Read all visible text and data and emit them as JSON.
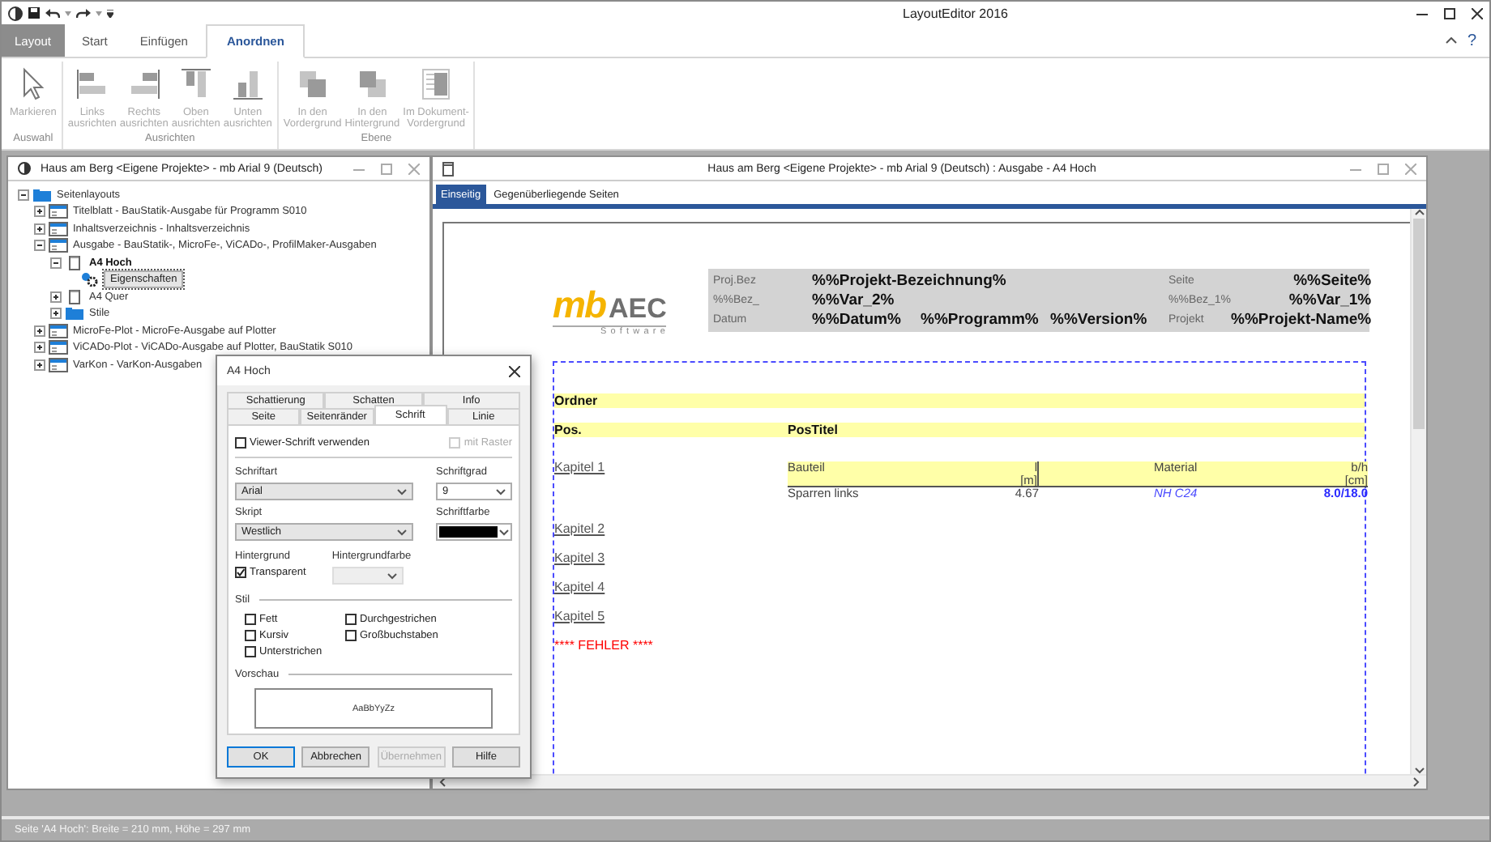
{
  "app": {
    "title": "LayoutEditor 2016"
  },
  "ribbon": {
    "tabs": [
      {
        "label": "Layout",
        "kind": "file",
        "selected": false
      },
      {
        "label": "Start",
        "kind": "tab",
        "selected": false
      },
      {
        "label": "Einfügen",
        "kind": "tab",
        "selected": false
      },
      {
        "label": "Anordnen",
        "kind": "tab",
        "selected": true
      }
    ],
    "help": "?",
    "groups": [
      {
        "label": "Auswahl",
        "buttons": [
          {
            "label": "Markieren",
            "disabled": true
          }
        ]
      },
      {
        "label": "Ausrichten",
        "buttons": [
          {
            "label": "Links\nausrichten",
            "disabled": true
          },
          {
            "label": "Rechts\nausrichten",
            "disabled": true
          },
          {
            "label": "Oben\nausrichten",
            "disabled": true
          },
          {
            "label": "Unten\nausrichten",
            "disabled": true
          }
        ]
      },
      {
        "label": "Ebene",
        "buttons": [
          {
            "label": "In den\nVordergrund",
            "disabled": true
          },
          {
            "label": "In den\nHintergrund",
            "disabled": true
          },
          {
            "label": "Im Dokument-\nVordergrund",
            "disabled": true
          }
        ]
      }
    ]
  },
  "tree_window": {
    "title": "Haus am Berg <Eigene Projekte> - mb Arial 9 (Deutsch)",
    "tree": [
      {
        "label": "Seitenlayouts",
        "kind": "folder",
        "expanded": true,
        "selected": false,
        "current": false,
        "children": [
          {
            "label": "Titelblatt - BauStatik-Ausgabe für Programm S010",
            "kind": "layout",
            "expanded": false,
            "selected": false,
            "current": false
          },
          {
            "label": "Inhaltsverzeichnis - Inhaltsverzeichnis",
            "kind": "layout",
            "expanded": false,
            "selected": false,
            "current": false
          },
          {
            "label": "Ausgabe - BauStatik-, MicroFe-, ViCADo-, ProfilMaker-Ausgaben",
            "kind": "layout",
            "expanded": true,
            "selected": false,
            "current": false,
            "children": [
              {
                "label": "A4 Hoch",
                "kind": "page",
                "expanded": true,
                "selected": false,
                "current": true,
                "children": [
                  {
                    "label": "Eigenschaften",
                    "kind": "properties",
                    "selected": true,
                    "current": false
                  }
                ]
              },
              {
                "label": "A4 Quer",
                "kind": "page",
                "expanded": false,
                "selected": false,
                "current": false
              },
              {
                "label": "Stile",
                "kind": "folder",
                "expanded": false,
                "selected": false,
                "current": false
              }
            ]
          },
          {
            "label": "MicroFe-Plot - MicroFe-Ausgabe auf Plotter",
            "kind": "layout",
            "expanded": false,
            "selected": false,
            "current": false
          },
          {
            "label": "ViCADo-Plot - ViCADo-Ausgabe auf Plotter, BauStatik S010",
            "kind": "layout",
            "expanded": false,
            "selected": false,
            "current": false
          },
          {
            "label": "VarKon - VarKon-Ausgaben",
            "kind": "layout",
            "expanded": false,
            "selected": false,
            "current": false
          }
        ]
      }
    ]
  },
  "document_window": {
    "title": "Haus am Berg <Eigene Projekte> - mb Arial 9 (Deutsch) : Ausgabe - A4 Hoch",
    "tabs": [
      {
        "label": "Einseitig",
        "selected": true
      },
      {
        "label": "Gegenüberliegende Seiten",
        "selected": false
      }
    ],
    "page": {
      "logo": {
        "mark": "mb",
        "name": "AEC",
        "tagline": "Software"
      },
      "header": [
        [
          {
            "text": "Proj.Bez",
            "kind": "label"
          },
          {
            "text": "%%Projekt-Bezeichnung%",
            "kind": "value"
          },
          {
            "text": "Seite",
            "kind": "label"
          },
          {
            "text": "%%Seite%",
            "kind": "value"
          }
        ],
        [
          {
            "text": "%%Bez_",
            "kind": "label"
          },
          {
            "text": "%%Var_2%",
            "kind": "value"
          },
          {
            "text": "%%Bez_1%",
            "kind": "label"
          },
          {
            "text": "%%Var_1%",
            "kind": "value"
          }
        ],
        [
          {
            "text": "Datum",
            "kind": "label"
          },
          {
            "text": "%%Datum%",
            "kind": "value"
          },
          {
            "text": "%%Programm%",
            "kind": "value"
          },
          {
            "text": "%%Version%",
            "kind": "value"
          },
          {
            "text": "Projekt",
            "kind": "label"
          },
          {
            "text": "%%Projekt-Name%",
            "kind": "value"
          }
        ]
      ],
      "body": [
        {
          "kind": "band",
          "cells": [
            "Ordner"
          ]
        },
        {
          "kind": "band",
          "cells": [
            "Pos.",
            "PosTitel"
          ]
        },
        {
          "kind": "chapter",
          "text": "Kapitel 1"
        },
        {
          "kind": "table",
          "columns": [
            {
              "label": "Bauteil"
            },
            {
              "label": "l",
              "unit": "[m]"
            },
            {
              "label": "Material"
            },
            {
              "label": "b/h",
              "unit": "[cm]"
            }
          ],
          "rows": [
            [
              {
                "text": "Sparren links",
                "kind": "plain"
              },
              {
                "text": "4.67",
                "kind": "plain"
              },
              {
                "text": "NH C24",
                "kind": "material"
              },
              {
                "text": "8.0/18.0",
                "kind": "section"
              }
            ]
          ]
        },
        {
          "kind": "chapter",
          "text": "Kapitel 2"
        },
        {
          "kind": "chapter",
          "text": "Kapitel 3"
        },
        {
          "kind": "chapter",
          "text": "Kapitel 4"
        },
        {
          "kind": "chapter",
          "text": "Kapitel 5"
        },
        {
          "kind": "error",
          "text": "**** FEHLER ****"
        }
      ]
    }
  },
  "dialog": {
    "title": "A4 Hoch",
    "tabs": [
      [
        {
          "label": "Schattierung",
          "selected": false
        },
        {
          "label": "Schatten",
          "selected": false
        },
        {
          "label": "Info",
          "selected": false
        }
      ],
      [
        {
          "label": "Seite",
          "selected": false
        },
        {
          "label": "Seitenränder",
          "selected": false
        },
        {
          "label": "Schrift",
          "selected": true
        },
        {
          "label": "Linie",
          "selected": false
        }
      ]
    ],
    "viewer_font": {
      "label": "Viewer-Schrift verwenden",
      "checked": false
    },
    "grid": {
      "label": "mit Raster",
      "checked": false,
      "disabled": true
    },
    "font": {
      "label": "Schriftart",
      "value": "Arial"
    },
    "size": {
      "label": "Schriftgrad",
      "value": "9"
    },
    "script": {
      "label": "Skript",
      "value": "Westlich"
    },
    "font_color": {
      "label": "Schriftfarbe",
      "color": "#000000"
    },
    "background": {
      "label": "Hintergrund",
      "option": {
        "label": "Transparent",
        "checked": true
      }
    },
    "background_color": {
      "label": "Hintergrundfarbe",
      "disabled": true
    },
    "style": {
      "label": "Stil",
      "options": [
        {
          "label": "Fett",
          "checked": false
        },
        {
          "label": "Kursiv",
          "checked": false
        },
        {
          "label": "Unterstrichen",
          "checked": false
        },
        {
          "label": "Durchgestrichen",
          "checked": false
        },
        {
          "label": "Großbuchstaben",
          "checked": false
        }
      ]
    },
    "preview": {
      "label": "Vorschau",
      "sample": "AaBbYyZz"
    },
    "buttons": [
      {
        "label": "OK",
        "disabled": false,
        "default": true
      },
      {
        "label": "Abbrechen",
        "disabled": false,
        "default": false
      },
      {
        "label": "Übernehmen",
        "disabled": true,
        "default": false
      },
      {
        "label": "Hilfe",
        "disabled": false,
        "default": false
      }
    ]
  },
  "status_bar": "Seite 'A4 Hoch': Breite = 210 mm, Höhe = 297 mm"
}
